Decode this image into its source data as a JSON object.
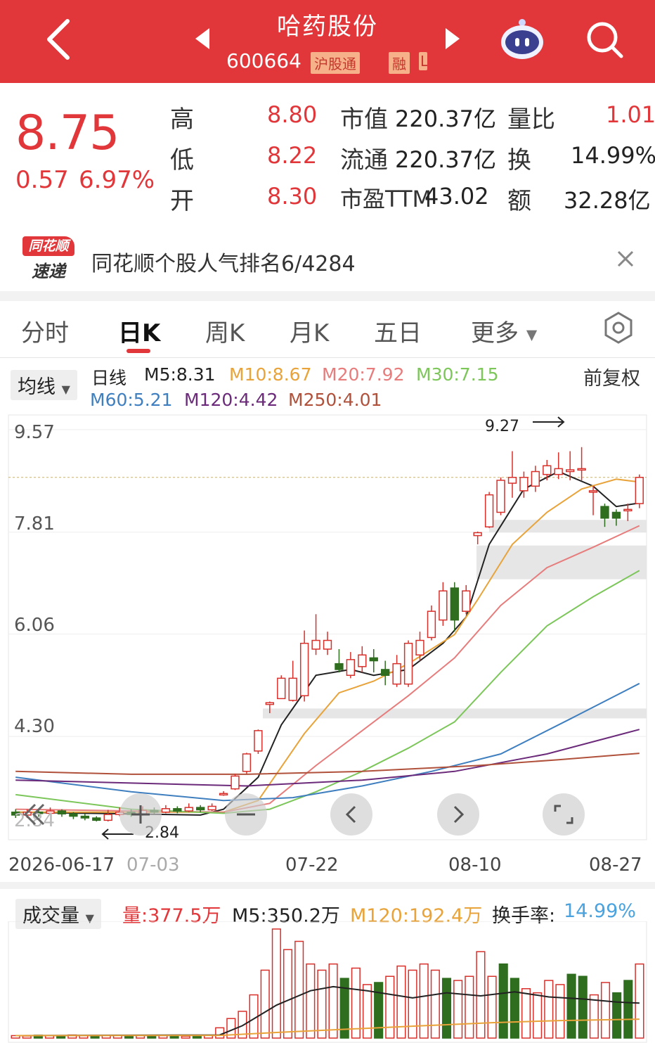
{
  "header": {
    "stock_name": "哈药股份",
    "stock_code": "600664",
    "badges": [
      "沪股通",
      "融",
      "L"
    ],
    "icons": [
      "back-icon",
      "prev-stock-icon",
      "next-stock-icon",
      "robot-icon",
      "search-icon"
    ]
  },
  "quote": {
    "price": "8.75",
    "change": "0.57",
    "change_pct": "6.97%",
    "stats": [
      {
        "label": "高",
        "value": "8.80"
      },
      {
        "label": "低",
        "value": "8.22"
      },
      {
        "label": "开",
        "value": "8.30"
      },
      {
        "label": "市值",
        "value": "220.37亿"
      },
      {
        "label": "流通",
        "value": "220.37亿"
      },
      {
        "label": "市盈TTM",
        "value": "43.02"
      },
      {
        "label": "量比",
        "value": "1.01"
      },
      {
        "label": "换",
        "value": "14.99%"
      },
      {
        "label": "额",
        "value": "32.28亿"
      }
    ]
  },
  "news": {
    "logo_top": "同花顺",
    "logo_bottom": "速递",
    "text": "同花顺个股人气排名6/4284"
  },
  "tabs": [
    "分时",
    "日K",
    "周K",
    "月K",
    "五日",
    "更多"
  ],
  "active_tab": "日K",
  "indicator_bar": {
    "dropdown": "均线",
    "period": "日线",
    "adjust": "前复权",
    "mas": [
      {
        "label": "M5:8.31",
        "color": "#222222"
      },
      {
        "label": "M10:8.67",
        "color": "#e8a33a"
      },
      {
        "label": "M20:7.92",
        "color": "#e77c7c"
      },
      {
        "label": "M30:7.15",
        "color": "#7cc65a"
      },
      {
        "label": "M60:5.21",
        "color": "#3f7fbf"
      },
      {
        "label": "M120:4.42",
        "color": "#6b2a7a"
      },
      {
        "label": "M250:4.01",
        "color": "#b0513b"
      }
    ]
  },
  "chart_data": {
    "type": "candlestick",
    "y_ticks": [
      "9.57",
      "7.81",
      "6.06",
      "4.30",
      "2.84"
    ],
    "x_ticks": [
      "2026-06-17",
      "07-03",
      "07-22",
      "08-10",
      "08-27"
    ],
    "annotations": [
      "9.27",
      "2.84"
    ],
    "current_price_line": 8.75,
    "candles": [
      {
        "o": 3.0,
        "c": 2.95,
        "h": 3.05,
        "l": 2.9
      },
      {
        "o": 2.95,
        "c": 3.0,
        "h": 3.05,
        "l": 2.9
      },
      {
        "o": 3.0,
        "c": 2.98,
        "h": 3.05,
        "l": 2.92
      },
      {
        "o": 2.98,
        "c": 3.02,
        "h": 3.08,
        "l": 2.95
      },
      {
        "o": 3.02,
        "c": 2.97,
        "h": 3.05,
        "l": 2.92
      },
      {
        "o": 2.97,
        "c": 2.93,
        "h": 3.0,
        "l": 2.88
      },
      {
        "o": 2.93,
        "c": 2.9,
        "h": 2.97,
        "l": 2.86
      },
      {
        "o": 2.9,
        "c": 2.86,
        "h": 2.93,
        "l": 2.84
      },
      {
        "o": 2.86,
        "c": 2.96,
        "h": 3.04,
        "l": 2.84
      },
      {
        "o": 2.96,
        "c": 3.0,
        "h": 3.08,
        "l": 2.93
      },
      {
        "o": 3.0,
        "c": 2.96,
        "h": 3.05,
        "l": 2.92
      },
      {
        "o": 2.96,
        "c": 3.03,
        "h": 3.1,
        "l": 2.94
      },
      {
        "o": 3.03,
        "c": 3.0,
        "h": 3.08,
        "l": 2.97
      },
      {
        "o": 3.0,
        "c": 3.06,
        "h": 3.12,
        "l": 2.98
      },
      {
        "o": 3.06,
        "c": 3.02,
        "h": 3.1,
        "l": 2.98
      },
      {
        "o": 3.02,
        "c": 3.08,
        "h": 3.15,
        "l": 3.0
      },
      {
        "o": 3.08,
        "c": 3.04,
        "h": 3.12,
        "l": 3.0
      },
      {
        "o": 3.04,
        "c": 3.1,
        "h": 3.15,
        "l": 3.02
      },
      {
        "o": 3.3,
        "c": 3.32,
        "h": 3.36,
        "l": 3.28
      },
      {
        "o": 3.4,
        "c": 3.62,
        "h": 3.66,
        "l": 3.38
      },
      {
        "o": 3.7,
        "c": 4.0,
        "h": 4.02,
        "l": 3.66
      },
      {
        "o": 4.05,
        "c": 4.4,
        "h": 4.42,
        "l": 4.0
      },
      {
        "o": 4.85,
        "c": 4.88,
        "h": 4.9,
        "l": 4.7
      },
      {
        "o": 4.95,
        "c": 5.3,
        "h": 5.35,
        "l": 4.95
      },
      {
        "o": 4.92,
        "c": 5.3,
        "h": 5.6,
        "l": 4.9
      },
      {
        "o": 5.0,
        "c": 5.9,
        "h": 6.12,
        "l": 4.9
      },
      {
        "o": 5.8,
        "c": 5.95,
        "h": 6.4,
        "l": 5.7
      },
      {
        "o": 5.8,
        "c": 5.95,
        "h": 6.1,
        "l": 5.7
      },
      {
        "o": 5.55,
        "c": 5.45,
        "h": 5.8,
        "l": 5.4
      },
      {
        "o": 5.35,
        "c": 5.62,
        "h": 5.75,
        "l": 5.3
      },
      {
        "o": 5.5,
        "c": 5.7,
        "h": 5.85,
        "l": 5.4
      },
      {
        "o": 5.65,
        "c": 5.6,
        "h": 5.8,
        "l": 5.4
      },
      {
        "o": 5.45,
        "c": 5.35,
        "h": 5.6,
        "l": 5.18
      },
      {
        "o": 5.2,
        "c": 5.55,
        "h": 5.7,
        "l": 5.15
      },
      {
        "o": 5.2,
        "c": 5.9,
        "h": 5.95,
        "l": 5.15
      },
      {
        "o": 5.7,
        "c": 5.95,
        "h": 6.1,
        "l": 5.6
      },
      {
        "o": 6.0,
        "c": 6.45,
        "h": 6.55,
        "l": 5.95
      },
      {
        "o": 6.3,
        "c": 6.8,
        "h": 6.95,
        "l": 6.2
      },
      {
        "o": 6.85,
        "c": 6.3,
        "h": 6.95,
        "l": 6.1
      },
      {
        "o": 6.45,
        "c": 6.8,
        "h": 6.9,
        "l": 6.4
      },
      {
        "o": 7.75,
        "c": 7.8,
        "h": 7.82,
        "l": 7.6
      },
      {
        "o": 7.9,
        "c": 8.45,
        "h": 8.5,
        "l": 7.88
      },
      {
        "o": 8.15,
        "c": 8.7,
        "h": 8.75,
        "l": 8.1
      },
      {
        "o": 8.65,
        "c": 8.75,
        "h": 9.2,
        "l": 8.4
      },
      {
        "o": 8.52,
        "c": 8.75,
        "h": 8.85,
        "l": 8.4
      },
      {
        "o": 8.6,
        "c": 8.85,
        "h": 8.95,
        "l": 8.5
      },
      {
        "o": 8.8,
        "c": 8.95,
        "h": 9.05,
        "l": 8.7
      },
      {
        "o": 8.8,
        "c": 8.9,
        "h": 9.18,
        "l": 8.72
      },
      {
        "o": 8.85,
        "c": 8.88,
        "h": 9.2,
        "l": 8.7
      },
      {
        "o": 8.88,
        "c": 8.9,
        "h": 9.27,
        "l": 8.7
      },
      {
        "o": 8.5,
        "c": 8.52,
        "h": 8.6,
        "l": 8.1
      },
      {
        "o": 8.25,
        "c": 8.05,
        "h": 8.3,
        "l": 7.9
      },
      {
        "o": 8.15,
        "c": 8.05,
        "h": 8.2,
        "l": 7.92
      },
      {
        "o": 8.18,
        "c": 8.2,
        "h": 8.3,
        "l": 8.0
      },
      {
        "o": 8.3,
        "c": 8.75,
        "h": 8.8,
        "l": 8.22
      }
    ],
    "ma_series": [
      {
        "name": "M5",
        "color": "#222222",
        "values": [
          [
            0,
            3.0
          ],
          [
            16,
            2.95
          ],
          [
            18,
            3.05
          ],
          [
            21,
            3.6
          ],
          [
            23,
            4.5
          ],
          [
            26,
            5.35
          ],
          [
            29,
            5.45
          ],
          [
            31,
            5.35
          ],
          [
            34,
            5.45
          ],
          [
            37,
            5.9
          ],
          [
            39,
            6.35
          ],
          [
            41,
            7.6
          ],
          [
            44,
            8.55
          ],
          [
            47,
            8.85
          ],
          [
            50,
            8.6
          ],
          [
            52,
            8.25
          ],
          [
            54,
            8.31
          ]
        ]
      },
      {
        "name": "M10",
        "color": "#e8a33a",
        "values": [
          [
            0,
            3.0
          ],
          [
            18,
            3.0
          ],
          [
            21,
            3.2
          ],
          [
            25,
            4.35
          ],
          [
            28,
            5.05
          ],
          [
            31,
            5.25
          ],
          [
            34,
            5.55
          ],
          [
            38,
            6.05
          ],
          [
            40,
            6.65
          ],
          [
            43,
            7.6
          ],
          [
            46,
            8.15
          ],
          [
            49,
            8.55
          ],
          [
            52,
            8.72
          ],
          [
            54,
            8.67
          ]
        ]
      },
      {
        "name": "M20",
        "color": "#e77c7c",
        "values": [
          [
            0,
            3.05
          ],
          [
            18,
            3.0
          ],
          [
            22,
            3.15
          ],
          [
            26,
            3.8
          ],
          [
            30,
            4.4
          ],
          [
            34,
            5.0
          ],
          [
            38,
            5.65
          ],
          [
            42,
            6.55
          ],
          [
            46,
            7.2
          ],
          [
            50,
            7.55
          ],
          [
            54,
            7.92
          ]
        ]
      },
      {
        "name": "M30",
        "color": "#7cc65a",
        "values": [
          [
            0,
            3.3
          ],
          [
            10,
            3.05
          ],
          [
            18,
            2.98
          ],
          [
            22,
            3.05
          ],
          [
            26,
            3.35
          ],
          [
            30,
            3.7
          ],
          [
            34,
            4.1
          ],
          [
            38,
            4.55
          ],
          [
            42,
            5.4
          ],
          [
            46,
            6.2
          ],
          [
            50,
            6.7
          ],
          [
            54,
            7.15
          ]
        ]
      },
      {
        "name": "M60",
        "color": "#3f7fbf",
        "values": [
          [
            0,
            3.6
          ],
          [
            10,
            3.35
          ],
          [
            18,
            3.2
          ],
          [
            24,
            3.25
          ],
          [
            30,
            3.45
          ],
          [
            36,
            3.7
          ],
          [
            42,
            4.0
          ],
          [
            48,
            4.6
          ],
          [
            54,
            5.21
          ]
        ]
      },
      {
        "name": "M120",
        "color": "#6b2a7a",
        "values": [
          [
            0,
            3.55
          ],
          [
            10,
            3.5
          ],
          [
            20,
            3.45
          ],
          [
            30,
            3.55
          ],
          [
            38,
            3.7
          ],
          [
            46,
            4.0
          ],
          [
            54,
            4.42
          ]
        ]
      },
      {
        "name": "M250",
        "color": "#b0513b",
        "values": [
          [
            0,
            3.7
          ],
          [
            10,
            3.65
          ],
          [
            20,
            3.65
          ],
          [
            30,
            3.7
          ],
          [
            40,
            3.8
          ],
          [
            47,
            3.9
          ],
          [
            54,
            4.01
          ]
        ]
      }
    ]
  },
  "volume_bar": {
    "dropdown": "成交量",
    "vol_label": "量:377.5万",
    "m5_label": "M5:350.2万",
    "m120_label": "M120:192.4万",
    "turnover_label": "换手率:",
    "turnover_value": "14.99%"
  },
  "volume_data": {
    "type": "bar",
    "values": [
      12,
      10,
      14,
      11,
      9,
      15,
      12,
      10,
      13,
      14,
      11,
      12,
      10,
      12,
      11,
      9,
      12,
      14,
      50,
      95,
      130,
      210,
      330,
      530,
      430,
      470,
      360,
      330,
      360,
      290,
      340,
      260,
      270,
      300,
      350,
      330,
      360,
      330,
      290,
      280,
      300,
      420,
      300,
      360,
      290,
      240,
      220,
      280,
      260,
      310,
      300,
      210,
      270,
      220,
      280,
      360
    ],
    "colors": [
      "up",
      "up",
      "down",
      "up",
      "down",
      "up",
      "up",
      "down",
      "up",
      "up",
      "down",
      "up",
      "down",
      "up",
      "down",
      "up",
      "down",
      "up",
      "up",
      "up",
      "up",
      "up",
      "up",
      "up",
      "up",
      "up",
      "up",
      "up",
      "up",
      "down",
      "up",
      "up",
      "down",
      "up",
      "up",
      "up",
      "up",
      "up",
      "down",
      "up",
      "up",
      "up",
      "up",
      "down",
      "down",
      "up",
      "up",
      "up",
      "up",
      "down",
      "down",
      "up",
      "up",
      "down",
      "down",
      "up"
    ],
    "ma5": [
      [
        0,
        12
      ],
      [
        18,
        15
      ],
      [
        20,
        60
      ],
      [
        23,
        160
      ],
      [
        26,
        230
      ],
      [
        28,
        250
      ],
      [
        31,
        230
      ],
      [
        35,
        195
      ],
      [
        38,
        220
      ],
      [
        41,
        205
      ],
      [
        44,
        225
      ],
      [
        47,
        200
      ],
      [
        50,
        190
      ],
      [
        53,
        175
      ],
      [
        55,
        170
      ]
    ],
    "ma120": [
      [
        0,
        12
      ],
      [
        18,
        13
      ],
      [
        24,
        30
      ],
      [
        30,
        45
      ],
      [
        36,
        60
      ],
      [
        42,
        75
      ],
      [
        48,
        85
      ],
      [
        55,
        92
      ]
    ]
  },
  "nav_buttons": [
    "collapse-left-icon",
    "zoom-in-icon",
    "zoom-out-icon",
    "pan-left-icon",
    "pan-right-icon",
    "fullscreen-icon"
  ]
}
